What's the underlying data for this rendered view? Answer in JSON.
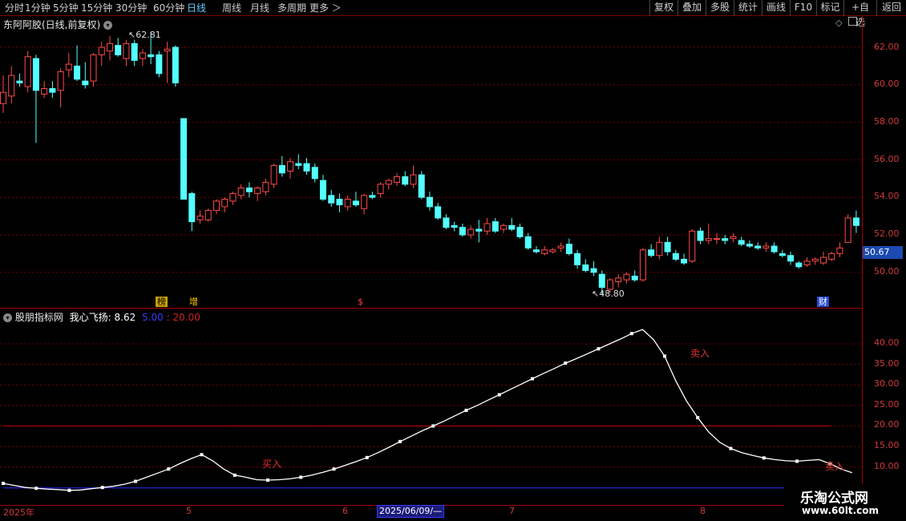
{
  "toolbar": {
    "periods": [
      "分时",
      "1分钟",
      "5分钟",
      "15分钟",
      "30分钟",
      "60分钟",
      "日线",
      "周线",
      "月线",
      "多周期",
      "更多 ＞"
    ],
    "active_period": "日线",
    "right_buttons": [
      "复权",
      "叠加",
      "多股",
      "统计",
      "画线",
      "F10",
      "标记",
      "+自选",
      "返回"
    ]
  },
  "main_panel": {
    "stock_title": "东阿阿胶(日线,前复权)",
    "y_ticks": [
      "62.00",
      "60.00",
      "58.00",
      "56.00",
      "54.00",
      "52.00",
      "50.00"
    ],
    "high_annotation": "62.81",
    "low_annotation": "48.80",
    "current_price": "50.67",
    "event_badges": [
      "榜",
      "增",
      "$",
      "财"
    ]
  },
  "indicator_panel": {
    "name": "股朋指标网",
    "indicator": "我心飞扬: 8.62",
    "level_low": "5.00",
    "level_high": "20.00",
    "y_ticks": [
      "40.00",
      "35.00",
      "30.00",
      "25.00",
      "20.00",
      "15.00",
      "10.00"
    ],
    "signals": [
      "买入",
      "卖入",
      "卖入"
    ]
  },
  "x_axis": {
    "labels": [
      "2025年",
      "5",
      "6",
      "7",
      "8"
    ],
    "cursor_date": "2025/06/09/—"
  },
  "watermark": {
    "line1": "乐淘公式网",
    "line2": "www.60lt.com"
  },
  "colors": {
    "up": "#ff4a4a",
    "down": "#54ffff",
    "indicator_line": "#ffffff",
    "level_low": "#2a2aff",
    "level_high": "#cc0000",
    "axis": "#d23a3a"
  },
  "chart_data": [
    {
      "type": "candlestick",
      "title": "东阿阿胶(日线,前复权)",
      "y_range": [
        48.8,
        62.81
      ],
      "candles": [
        {
          "o": 59,
          "h": 60.5,
          "l": 58.5,
          "c": 59.6
        },
        {
          "o": 59.4,
          "h": 61,
          "l": 59,
          "c": 60.5
        },
        {
          "o": 60.2,
          "h": 60.6,
          "l": 59.9,
          "c": 60.1
        },
        {
          "o": 59.9,
          "h": 61.8,
          "l": 59.6,
          "c": 61.5
        },
        {
          "o": 61.4,
          "h": 61.6,
          "l": 56.9,
          "c": 59.7
        },
        {
          "o": 59.5,
          "h": 60.2,
          "l": 59.3,
          "c": 59.8
        },
        {
          "o": 59.8,
          "h": 60.2,
          "l": 59.3,
          "c": 59.6
        },
        {
          "o": 59.7,
          "h": 60.9,
          "l": 58.8,
          "c": 60.7
        },
        {
          "o": 60.8,
          "h": 61.7,
          "l": 60.4,
          "c": 61.1
        },
        {
          "o": 61,
          "h": 62.1,
          "l": 60.2,
          "c": 60.3
        },
        {
          "o": 60.2,
          "h": 61.2,
          "l": 59.8,
          "c": 60
        },
        {
          "o": 60.2,
          "h": 61.7,
          "l": 59.9,
          "c": 61.6
        },
        {
          "o": 61.6,
          "h": 62.3,
          "l": 61,
          "c": 62
        },
        {
          "o": 61.8,
          "h": 62.6,
          "l": 61.3,
          "c": 62.2
        },
        {
          "o": 62.1,
          "h": 62.5,
          "l": 61.5,
          "c": 61.6
        },
        {
          "o": 61.4,
          "h": 62.4,
          "l": 61,
          "c": 62.2
        },
        {
          "o": 62.2,
          "h": 62.4,
          "l": 61,
          "c": 61.3
        },
        {
          "o": 61.4,
          "h": 61.9,
          "l": 61,
          "c": 61.7
        },
        {
          "o": 61.6,
          "h": 62.81,
          "l": 61.1,
          "c": 61.5
        },
        {
          "o": 61.6,
          "h": 61.8,
          "l": 60.4,
          "c": 60.6
        },
        {
          "o": 61.8,
          "h": 62.3,
          "l": 60.1,
          "c": 61.9
        },
        {
          "o": 62,
          "h": 62.1,
          "l": 59.9,
          "c": 60.1
        },
        {
          "o": 58.2,
          "h": 58.2,
          "l": 53.9,
          "c": 53.9
        },
        {
          "o": 54.2,
          "h": 54.3,
          "l": 52.2,
          "c": 52.7
        },
        {
          "o": 52.8,
          "h": 53.3,
          "l": 52.6,
          "c": 53
        },
        {
          "o": 52.8,
          "h": 53.4,
          "l": 52.7,
          "c": 53.3
        },
        {
          "o": 53.3,
          "h": 53.9,
          "l": 53.1,
          "c": 53.8
        },
        {
          "o": 53.5,
          "h": 54,
          "l": 53.2,
          "c": 53.9
        },
        {
          "o": 53.8,
          "h": 54.3,
          "l": 53.6,
          "c": 54.2
        },
        {
          "o": 54.1,
          "h": 54.7,
          "l": 53.9,
          "c": 54.5
        },
        {
          "o": 54.5,
          "h": 54.8,
          "l": 54,
          "c": 54.3
        },
        {
          "o": 54.2,
          "h": 54.6,
          "l": 53.8,
          "c": 54.5
        },
        {
          "o": 54.3,
          "h": 55,
          "l": 54.1,
          "c": 54.8
        },
        {
          "o": 54.7,
          "h": 55.8,
          "l": 54.5,
          "c": 55.7
        },
        {
          "o": 55.7,
          "h": 56.2,
          "l": 55.1,
          "c": 55.3
        },
        {
          "o": 55.4,
          "h": 56.1,
          "l": 55,
          "c": 55.9
        },
        {
          "o": 55.8,
          "h": 56.3,
          "l": 55.5,
          "c": 55.7
        },
        {
          "o": 55.8,
          "h": 56.1,
          "l": 55.2,
          "c": 55.4
        },
        {
          "o": 55.6,
          "h": 55.8,
          "l": 54.8,
          "c": 55
        },
        {
          "o": 54.9,
          "h": 55.2,
          "l": 53.8,
          "c": 53.9
        },
        {
          "o": 54.1,
          "h": 54.4,
          "l": 53.5,
          "c": 53.7
        },
        {
          "o": 53.9,
          "h": 54.2,
          "l": 53.2,
          "c": 53.6
        },
        {
          "o": 53.5,
          "h": 54.1,
          "l": 53.3,
          "c": 53.9
        },
        {
          "o": 53.8,
          "h": 54.3,
          "l": 53.5,
          "c": 53.6
        },
        {
          "o": 53.4,
          "h": 54.2,
          "l": 53.1,
          "c": 54.1
        },
        {
          "o": 54.1,
          "h": 54.3,
          "l": 53.9,
          "c": 54
        },
        {
          "o": 54.2,
          "h": 54.8,
          "l": 54,
          "c": 54.7
        },
        {
          "o": 54.7,
          "h": 55,
          "l": 54.4,
          "c": 54.9
        },
        {
          "o": 54.8,
          "h": 55.3,
          "l": 54.6,
          "c": 55.1
        },
        {
          "o": 55.1,
          "h": 55.4,
          "l": 54.6,
          "c": 54.7
        },
        {
          "o": 54.7,
          "h": 55.7,
          "l": 54.5,
          "c": 55.2
        },
        {
          "o": 55.2,
          "h": 55.4,
          "l": 53.9,
          "c": 54
        },
        {
          "o": 54,
          "h": 54.3,
          "l": 53.3,
          "c": 53.5
        },
        {
          "o": 53.5,
          "h": 53.7,
          "l": 52.8,
          "c": 52.9
        },
        {
          "o": 52.9,
          "h": 53.1,
          "l": 52.3,
          "c": 52.4
        },
        {
          "o": 52.5,
          "h": 52.7,
          "l": 52.2,
          "c": 52.4
        },
        {
          "o": 52.4,
          "h": 52.6,
          "l": 51.9,
          "c": 52
        },
        {
          "o": 52,
          "h": 52.5,
          "l": 51.8,
          "c": 52.3
        },
        {
          "o": 52.3,
          "h": 52.8,
          "l": 51.6,
          "c": 52.2
        },
        {
          "o": 52.2,
          "h": 52.9,
          "l": 52,
          "c": 52.6
        },
        {
          "o": 52.7,
          "h": 52.9,
          "l": 52.1,
          "c": 52.2
        },
        {
          "o": 52.3,
          "h": 52.6,
          "l": 52.1,
          "c": 52.5
        },
        {
          "o": 52.5,
          "h": 52.9,
          "l": 52.2,
          "c": 52.3
        },
        {
          "o": 52.4,
          "h": 52.6,
          "l": 51.8,
          "c": 51.9
        },
        {
          "o": 51.9,
          "h": 52.1,
          "l": 51.2,
          "c": 51.3
        },
        {
          "o": 51.2,
          "h": 51.4,
          "l": 51,
          "c": 51.1
        },
        {
          "o": 51,
          "h": 51.4,
          "l": 50.9,
          "c": 51.2
        },
        {
          "o": 51.1,
          "h": 51.3,
          "l": 51,
          "c": 51.2
        },
        {
          "o": 51.3,
          "h": 51.6,
          "l": 51.1,
          "c": 51.4
        },
        {
          "o": 51.5,
          "h": 51.8,
          "l": 50.9,
          "c": 51
        },
        {
          "o": 51,
          "h": 51.2,
          "l": 50.2,
          "c": 50.4
        },
        {
          "o": 50.4,
          "h": 50.7,
          "l": 50,
          "c": 50.1
        },
        {
          "o": 50.2,
          "h": 50.6,
          "l": 49.8,
          "c": 50
        },
        {
          "o": 49.9,
          "h": 50.1,
          "l": 48.8,
          "c": 49.2
        },
        {
          "o": 49.1,
          "h": 49.7,
          "l": 48.9,
          "c": 49.6
        },
        {
          "o": 49.5,
          "h": 49.9,
          "l": 49.2,
          "c": 49.7
        },
        {
          "o": 49.6,
          "h": 50,
          "l": 49.4,
          "c": 49.9
        },
        {
          "o": 49.8,
          "h": 50.1,
          "l": 49.5,
          "c": 49.6
        },
        {
          "o": 49.6,
          "h": 51.3,
          "l": 49.5,
          "c": 51.2
        },
        {
          "o": 51.2,
          "h": 51.5,
          "l": 50.8,
          "c": 50.9
        },
        {
          "o": 50.9,
          "h": 51.9,
          "l": 50.7,
          "c": 51.6
        },
        {
          "o": 51.6,
          "h": 51.9,
          "l": 50.9,
          "c": 51.1
        },
        {
          "o": 51,
          "h": 51.2,
          "l": 50.6,
          "c": 50.7
        },
        {
          "o": 50.7,
          "h": 51,
          "l": 50.4,
          "c": 50.5
        },
        {
          "o": 50.6,
          "h": 52.3,
          "l": 50.5,
          "c": 52.2
        },
        {
          "o": 52.2,
          "h": 52.4,
          "l": 51.5,
          "c": 51.7
        },
        {
          "o": 51.7,
          "h": 52.6,
          "l": 51.5,
          "c": 51.8
        },
        {
          "o": 51.8,
          "h": 52.1,
          "l": 51.5,
          "c": 51.8
        },
        {
          "o": 51.8,
          "h": 52,
          "l": 51.5,
          "c": 51.7
        },
        {
          "o": 51.8,
          "h": 52.1,
          "l": 51.6,
          "c": 51.9
        },
        {
          "o": 51.7,
          "h": 51.9,
          "l": 51.4,
          "c": 51.5
        },
        {
          "o": 51.5,
          "h": 51.7,
          "l": 51.3,
          "c": 51.4
        },
        {
          "o": 51.4,
          "h": 51.6,
          "l": 51.2,
          "c": 51.3
        },
        {
          "o": 51.3,
          "h": 51.6,
          "l": 51.1,
          "c": 51.4
        },
        {
          "o": 51.4,
          "h": 51.6,
          "l": 51,
          "c": 51.1
        },
        {
          "o": 51,
          "h": 51.2,
          "l": 50.8,
          "c": 50.9
        },
        {
          "o": 50.9,
          "h": 51.1,
          "l": 50.4,
          "c": 50.6
        },
        {
          "o": 50.5,
          "h": 50.6,
          "l": 50.2,
          "c": 50.3
        },
        {
          "o": 50.4,
          "h": 50.8,
          "l": 50.3,
          "c": 50.6
        },
        {
          "o": 50.6,
          "h": 50.8,
          "l": 50.4,
          "c": 50.7
        },
        {
          "o": 50.5,
          "h": 51.1,
          "l": 50.4,
          "c": 50.8
        },
        {
          "o": 50.7,
          "h": 51.1,
          "l": 50.6,
          "c": 51
        },
        {
          "o": 51,
          "h": 51.6,
          "l": 50.8,
          "c": 51.3
        },
        {
          "o": 51.6,
          "h": 53.1,
          "l": 51.6,
          "c": 52.9
        },
        {
          "o": 52.9,
          "h": 53.3,
          "l": 52.1,
          "c": 52.5
        }
      ]
    },
    {
      "type": "line",
      "title": "我心飞扬",
      "y_range": [
        5,
        45
      ],
      "levels": [
        5,
        20
      ],
      "values": [
        6,
        5.5,
        5,
        4.8,
        4.6,
        4.5,
        4.3,
        4.4,
        4.7,
        5,
        5.3,
        5.8,
        6.5,
        7.5,
        8.5,
        9.5,
        10.8,
        12,
        13,
        11.5,
        9.5,
        8,
        7.5,
        6.9,
        6.8,
        6.9,
        7.1,
        7.5,
        8,
        8.7,
        9.5,
        10.4,
        11.3,
        12.3,
        13.5,
        14.8,
        16.2,
        17.5,
        18.8,
        20,
        21.2,
        22.5,
        23.8,
        25,
        26.3,
        27.6,
        28.9,
        30.2,
        31.5,
        32.8,
        34,
        35.3,
        36.4,
        37.6,
        38.8,
        40,
        41.2,
        42.5,
        43.5,
        41,
        37,
        31,
        26,
        22,
        18.5,
        16,
        14.5,
        13.5,
        12.8,
        12.2,
        11.8,
        11.5,
        11.4,
        11.6,
        11.8,
        10.8,
        9.5,
        8.62
      ]
    }
  ]
}
